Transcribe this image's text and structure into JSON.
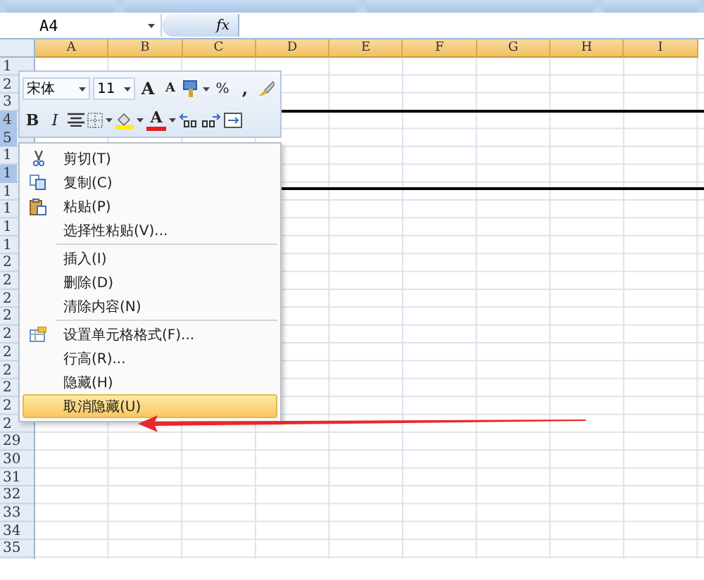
{
  "formula_bar": {
    "name_box": "A4",
    "fx": "fx"
  },
  "columns": [
    "A",
    "B",
    "C",
    "D",
    "E",
    "F",
    "G",
    "H",
    "I"
  ],
  "rows": [
    {
      "label": "1",
      "selected": false
    },
    {
      "label": "2",
      "selected": false
    },
    {
      "label": "3",
      "selected": false
    },
    {
      "label": "4",
      "selected": true
    },
    {
      "label": "5",
      "selected": true
    },
    {
      "label": "1",
      "selected": false
    },
    {
      "label": "1",
      "selected": true
    },
    {
      "label": "1",
      "selected": false
    },
    {
      "label": "1",
      "selected": false
    },
    {
      "label": "1",
      "selected": false
    },
    {
      "label": "1",
      "selected": false
    },
    {
      "label": "2",
      "selected": false
    },
    {
      "label": "2",
      "selected": false
    },
    {
      "label": "2",
      "selected": false
    },
    {
      "label": "2",
      "selected": false
    },
    {
      "label": "2",
      "selected": false
    },
    {
      "label": "2",
      "selected": false
    },
    {
      "label": "2",
      "selected": false
    },
    {
      "label": "2",
      "selected": false
    },
    {
      "label": "2",
      "selected": false
    },
    {
      "label": "2",
      "selected": false
    },
    {
      "label": "29",
      "selected": false
    },
    {
      "label": "30",
      "selected": false
    },
    {
      "label": "31",
      "selected": false
    },
    {
      "label": "32",
      "selected": false
    },
    {
      "label": "33",
      "selected": false
    },
    {
      "label": "34",
      "selected": false
    },
    {
      "label": "35",
      "selected": false
    }
  ],
  "mini_toolbar": {
    "font": "宋体",
    "size": "11",
    "grow": "A",
    "shrink": "A",
    "percent": "%",
    "comma": ",",
    "bold": "B",
    "italic": "I",
    "font_color": "A"
  },
  "context_menu": [
    {
      "kind": "cut",
      "label": "剪切(T)",
      "selected": false
    },
    {
      "kind": "copy",
      "label": "复制(C)",
      "selected": false
    },
    {
      "kind": "paste",
      "label": "粘贴(P)",
      "selected": false
    },
    {
      "kind": "plain",
      "label": "选择性粘贴(V)...",
      "selected": false
    },
    {
      "kind": "separator"
    },
    {
      "kind": "plain",
      "label": "插入(I)",
      "selected": false
    },
    {
      "kind": "plain",
      "label": "删除(D)",
      "selected": false
    },
    {
      "kind": "plain",
      "label": "清除内容(N)",
      "selected": false
    },
    {
      "kind": "separator"
    },
    {
      "kind": "format",
      "label": "设置单元格格式(F)...",
      "selected": false
    },
    {
      "kind": "plain",
      "label": "行高(R)...",
      "selected": false
    },
    {
      "kind": "plain",
      "label": "隐藏(H)",
      "selected": false
    },
    {
      "kind": "plain",
      "label": "取消隐藏(U)",
      "selected": true
    }
  ]
}
